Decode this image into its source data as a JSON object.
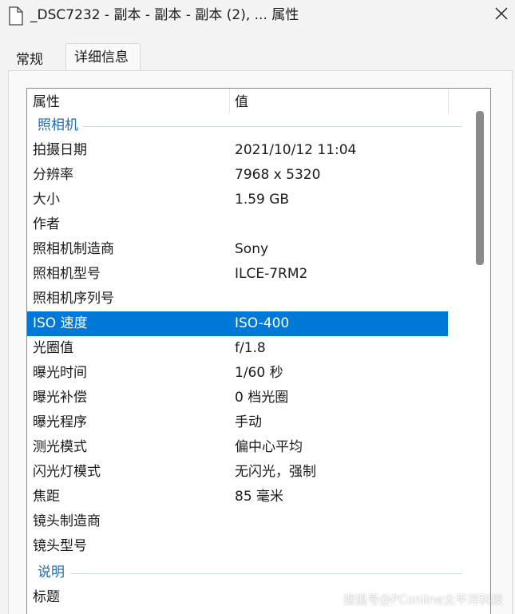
{
  "window": {
    "title": "_DSC7232 - 副本 - 副本 - 副本 (2), ... 属性",
    "close_icon": "close-icon"
  },
  "tabs": [
    {
      "label": "常规",
      "active": false
    },
    {
      "label": "详细信息",
      "active": true
    }
  ],
  "columns": {
    "property": "属性",
    "value": "值"
  },
  "groups": {
    "camera": "照相机",
    "description": "说明"
  },
  "camera_rows": [
    {
      "key": "拍摄日期",
      "value": "2021/10/12 11:04"
    },
    {
      "key": "分辨率",
      "value": "7968 x 5320"
    },
    {
      "key": "大小",
      "value": "1.59 GB"
    },
    {
      "key": "作者",
      "value": ""
    },
    {
      "key": "照相机制造商",
      "value": "Sony"
    },
    {
      "key": "照相机型号",
      "value": "ILCE-7RM2"
    },
    {
      "key": "照相机序列号",
      "value": ""
    },
    {
      "key": "ISO 速度",
      "value": "ISO-400",
      "selected": true
    },
    {
      "key": "光圈值",
      "value": "f/1.8"
    },
    {
      "key": "曝光时间",
      "value": "1/60 秒"
    },
    {
      "key": "曝光补偿",
      "value": "0 档光圈"
    },
    {
      "key": "曝光程序",
      "value": "手动"
    },
    {
      "key": "测光模式",
      "value": "偏中心平均"
    },
    {
      "key": "闪光灯模式",
      "value": "无闪光，强制"
    },
    {
      "key": "焦距",
      "value": "85 毫米"
    },
    {
      "key": "镜头制造商",
      "value": ""
    },
    {
      "key": "镜头型号",
      "value": ""
    }
  ],
  "description_rows": [
    {
      "key": "标题",
      "value": ""
    }
  ],
  "watermark": "搜狐号@PConline太平洋科技",
  "colors": {
    "selection": "#0078d7",
    "group_label": "#1e6bb8"
  }
}
